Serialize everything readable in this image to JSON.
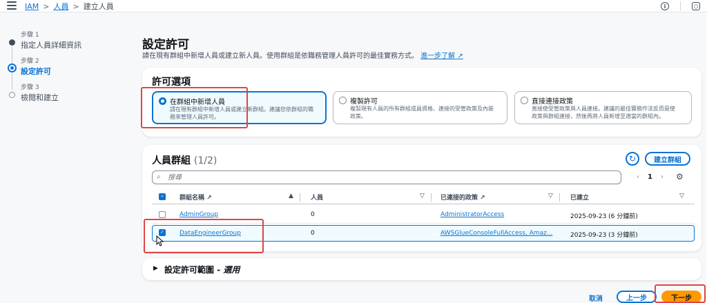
{
  "breadcrumb": {
    "service": "IAM",
    "section": "人員",
    "current": "建立人員"
  },
  "top_icons": {
    "info": "info-icon",
    "settings": "settings-hex-icon"
  },
  "steps": [
    {
      "num": "步驟 1",
      "label": "指定人員詳細資訊",
      "state": "done"
    },
    {
      "num": "步驟 2",
      "label": "設定許可",
      "state": "active"
    },
    {
      "num": "步驟 3",
      "label": "檢閱和建立",
      "state": "todo"
    }
  ],
  "page": {
    "title": "設定許可",
    "description": "請在現有群組中新增人員或建立新人員。使用群組是依職務管理人員許可的最佳實務方式。",
    "learn_more": "進一步了解"
  },
  "permission_options": {
    "heading": "許可選項",
    "options": [
      {
        "title": "在群組中新增人員",
        "desc": "請在現有群組中新增人員或建立新群組。建議您依群組的職務來管理人員許可。",
        "selected": true
      },
      {
        "title": "複製許可",
        "desc": "複製現有人員的所有群組成員資格、連接的受管政策及內嵌政策。",
        "selected": false
      },
      {
        "title": "直接連接政策",
        "desc": "直接使受管政策與人員連接。建議的最佳實務作法反而是使政策與群組連接，然後再將人員新增至適當的群組內。",
        "selected": false
      }
    ]
  },
  "groups": {
    "heading": "人員群組",
    "count": "(1/2)",
    "create_label": "建立群組",
    "search_placeholder": "搜尋",
    "page": "1",
    "columns": {
      "name": "群組名稱",
      "users": "人員",
      "policies": "已連接的政策",
      "created": "已建立"
    },
    "rows": [
      {
        "name": "AdminGroup",
        "users": "0",
        "policies": "AdministratorAccess",
        "created": "2025-09-23 (6 分鐘前)",
        "checked": false
      },
      {
        "name": "DataEngineerGroup",
        "users": "0",
        "policies": "AWSGlueConsoleFullAccess, Amaz...",
        "created": "2025-09-23 (3 分鐘前)",
        "checked": true
      }
    ]
  },
  "boundary": {
    "label": "設定許可範圍 - ",
    "optional": "選用"
  },
  "actions": {
    "cancel": "取消",
    "previous": "上一步",
    "next": "下一步"
  },
  "colors": {
    "accent": "#0972d3",
    "primary_button": "#ff9900",
    "highlight": "#e04444"
  }
}
